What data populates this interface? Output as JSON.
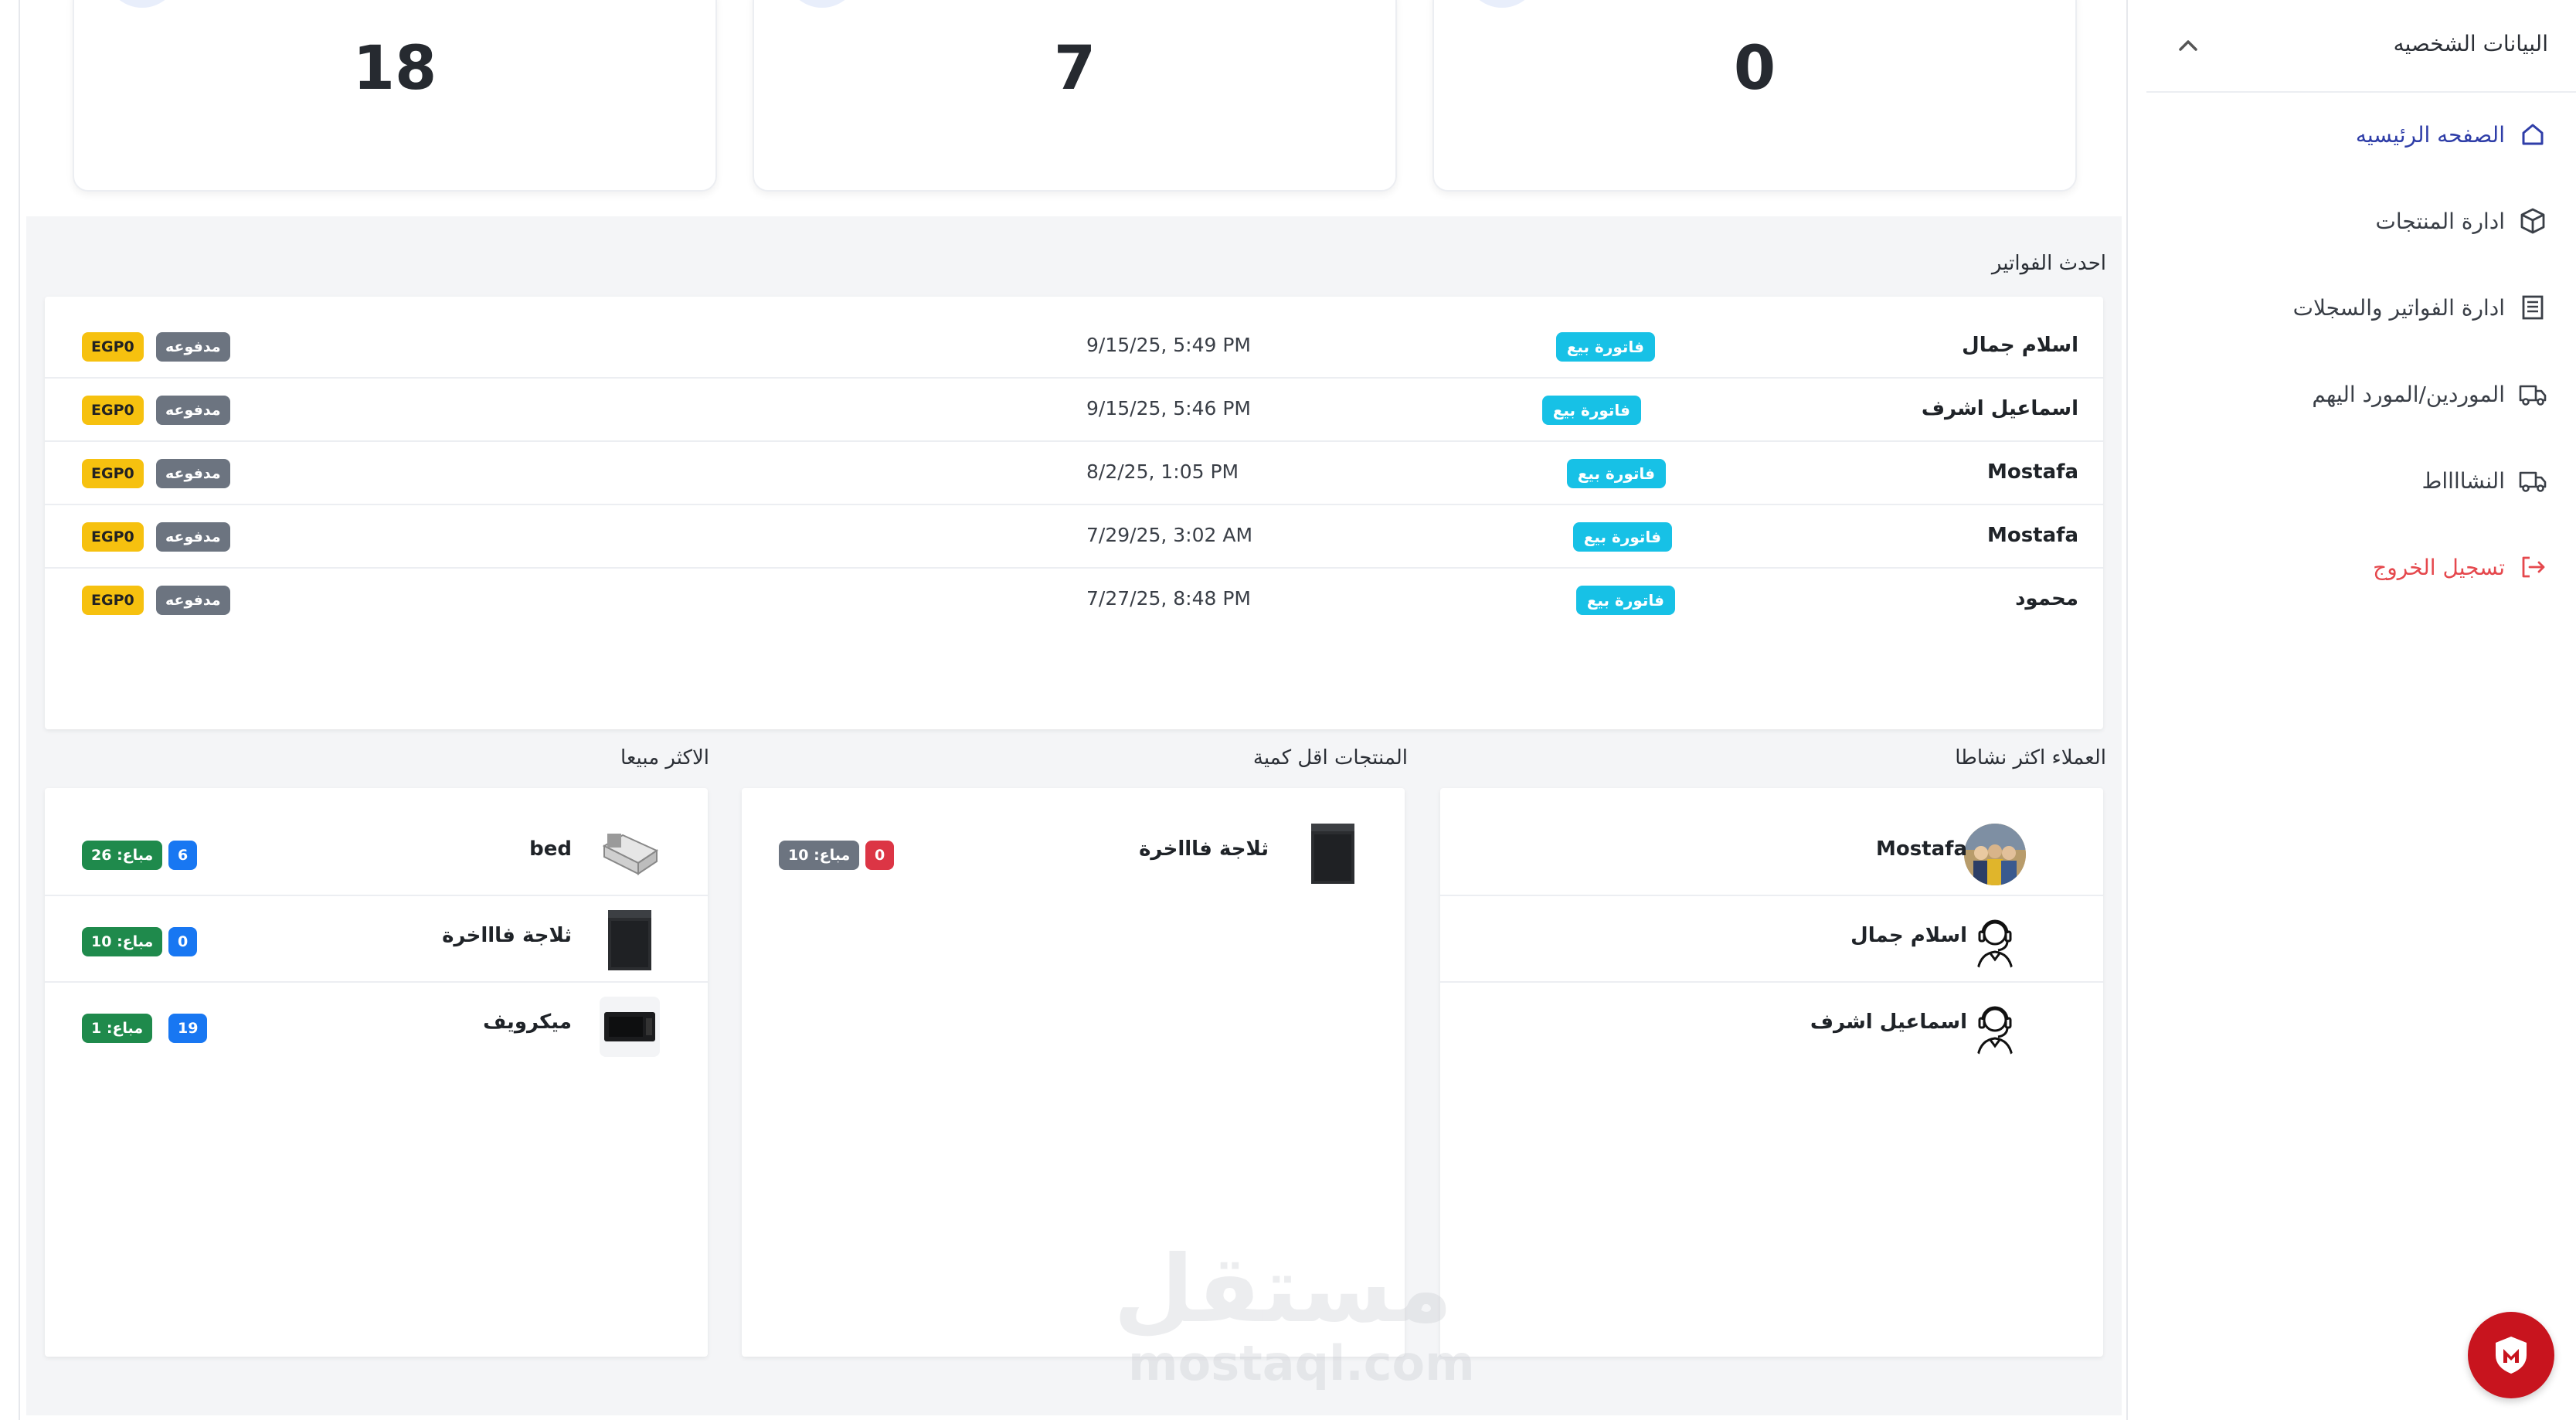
{
  "stats": [
    {
      "value": "18"
    },
    {
      "value": "7"
    },
    {
      "value": "0"
    }
  ],
  "invoices": {
    "title": "احدث الفواتير",
    "rows": [
      {
        "name": "اسلام جمال",
        "type": "فاتورة بيع",
        "date": "9/15/25, 5:49 PM",
        "status": "مدفوعه",
        "amount": "EGP0"
      },
      {
        "name": "اسماعيل اشرف",
        "type": "فاتورة بيع",
        "date": "9/15/25, 5:46 PM",
        "status": "مدفوعه",
        "amount": "EGP0"
      },
      {
        "name": "Mostafa",
        "type": "فاتورة بيع",
        "date": "8/2/25, 1:05 PM",
        "status": "مدفوعه",
        "amount": "EGP0"
      },
      {
        "name": "Mostafa",
        "type": "فاتورة بيع",
        "date": "7/29/25, 3:02 AM",
        "status": "مدفوعه",
        "amount": "EGP0"
      },
      {
        "name": "محمود",
        "type": "فاتورة بيع",
        "date": "7/27/25, 8:48 PM",
        "status": "مدفوعه",
        "amount": "EGP0"
      }
    ]
  },
  "active_customers": {
    "title": "العملاء اكثر نشاطا",
    "items": [
      {
        "name": "Mostafa",
        "avatar": "photo-avatar"
      },
      {
        "name": "اسلام جمال",
        "avatar": "support-agent-icon"
      },
      {
        "name": "اسماعيل اشرف",
        "avatar": "support-agent-icon"
      }
    ]
  },
  "low_stock": {
    "title": "المنتجات اقل كمية",
    "items": [
      {
        "name": "ثلاجة فاااخرة",
        "qty": "0",
        "sold": "مباع: 10"
      }
    ]
  },
  "best_sellers": {
    "title": "الاكثر مبيعا",
    "items": [
      {
        "name": "bed",
        "qty": "6",
        "sold": "مباع: 26"
      },
      {
        "name": "ثلاجة فاااخرة",
        "qty": "0",
        "sold": "مباع: 10"
      },
      {
        "name": "ميكرويف",
        "qty": "19",
        "sold": "مباع: 1"
      }
    ]
  },
  "sidebar": {
    "header": "البيانات الشخصيه",
    "items": [
      {
        "label": "الصفحه الرئيسيه",
        "icon": "home-icon"
      },
      {
        "label": "ادارة المنتجات",
        "icon": "box-icon"
      },
      {
        "label": "ادارة الفواتير والسجلات",
        "icon": "invoice-icon"
      },
      {
        "label": "الموردين/المورد اليهم",
        "icon": "truck-icon"
      },
      {
        "label": "النشااااط",
        "icon": "truck-icon"
      },
      {
        "label": "تسجيل الخروج",
        "icon": "logout-icon"
      }
    ]
  },
  "watermark": {
    "arabic": "مستقل",
    "latin": "mostaql.com"
  },
  "colors": {
    "primary": "#2f3ea8",
    "invoice_type": "#17c1e6",
    "paid": "#6c7480",
    "amount": "#f6c10f",
    "danger": "#e5484d",
    "fab": "#c8141e"
  }
}
